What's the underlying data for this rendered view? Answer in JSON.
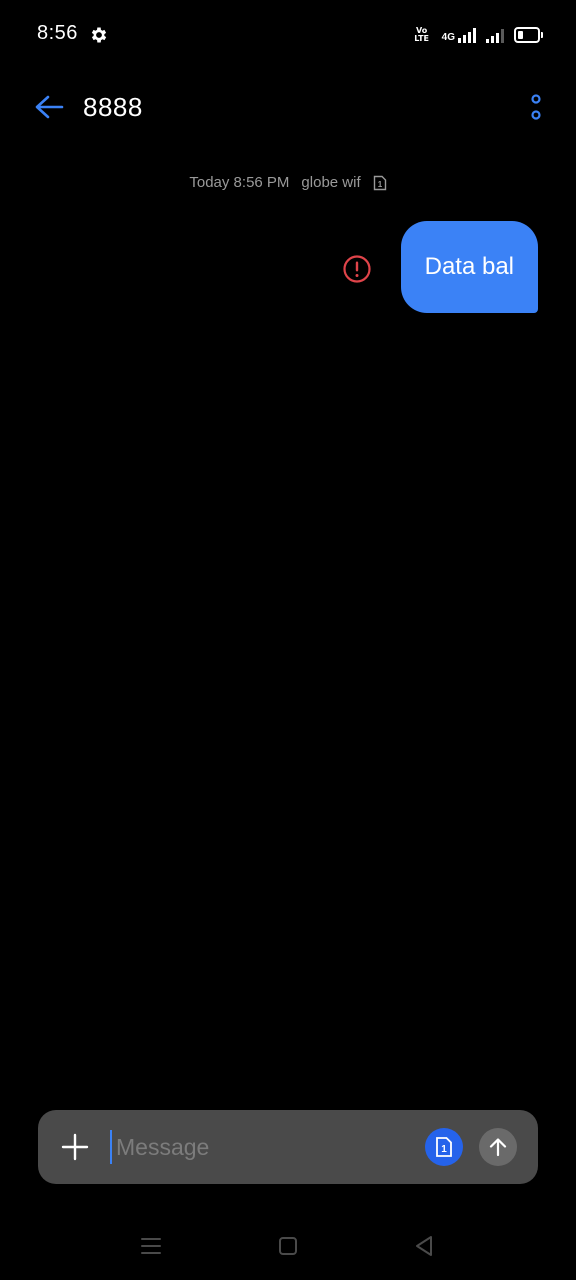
{
  "status_bar": {
    "time": "8:56",
    "volte_top": "Vo",
    "volte_bottom": "LTE",
    "network_type": "4G",
    "battery_level_percent": 30
  },
  "app_bar": {
    "title": "8888",
    "back_icon": "arrow-left-icon",
    "more_icon": "more-vertical-icon",
    "accent_color": "#3b82f6"
  },
  "conversation": {
    "meta_time": "Today 8:56 PM",
    "meta_sim": "globe wif",
    "messages": [
      {
        "direction": "outgoing",
        "text": "Data bal",
        "status": "failed",
        "bubble_color": "#3b82f6"
      }
    ],
    "error_color": "#e0444a"
  },
  "composer": {
    "placeholder": "Message",
    "value": "",
    "sim_slot": "1",
    "add_icon": "plus-icon",
    "send_icon": "arrow-up-icon"
  },
  "nav_bar": {
    "menu_icon": "menu-icon",
    "home_icon": "square-icon",
    "back_icon": "triangle-back-icon"
  }
}
